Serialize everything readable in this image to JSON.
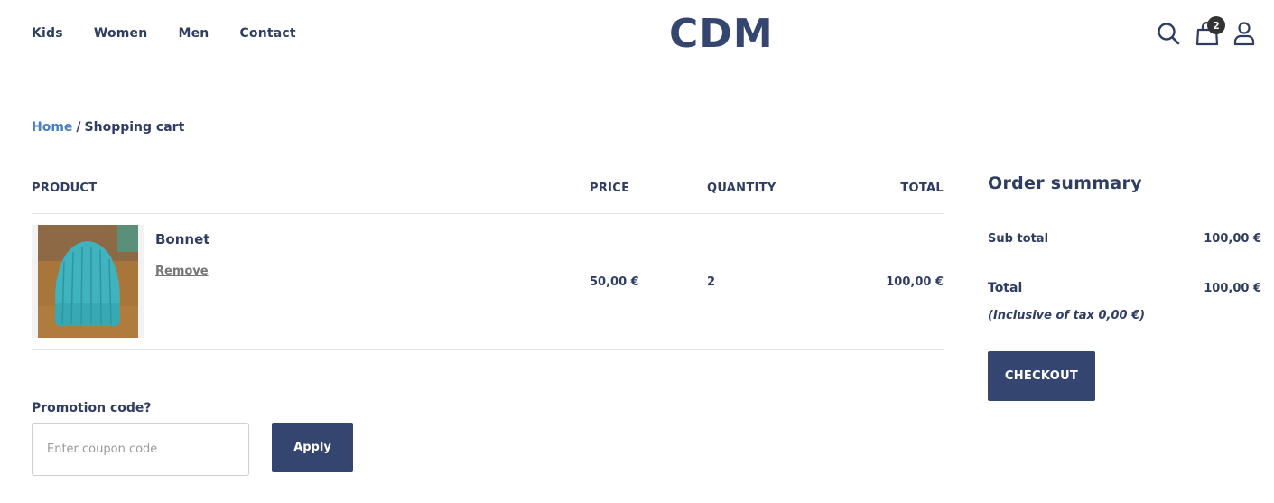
{
  "header": {
    "nav": [
      "Kids",
      "Women",
      "Men",
      "Contact"
    ],
    "logo": "CDM",
    "cart_count": "2",
    "brand_color": "#34456f"
  },
  "breadcrumb": {
    "home": "Home",
    "separator": "/",
    "current": "Shopping cart"
  },
  "cart": {
    "columns": {
      "product": "PRODUCT",
      "price": "PRICE",
      "quantity": "QUANTITY",
      "total": "TOTAL"
    },
    "items": [
      {
        "name": "Bonnet",
        "remove_label": "Remove",
        "price": "50,00 €",
        "quantity": "2",
        "total": "100,00 €"
      }
    ]
  },
  "promo": {
    "label": "Promotion code?",
    "placeholder": "Enter coupon code",
    "apply_label": "Apply"
  },
  "summary": {
    "title": "Order summary",
    "subtotal_label": "Sub total",
    "subtotal_value": "100,00 €",
    "total_label": "Total",
    "total_value": "100,00 €",
    "tax_note": "(Inclusive of tax 0,00 €)",
    "checkout_label": "CHECKOUT"
  }
}
